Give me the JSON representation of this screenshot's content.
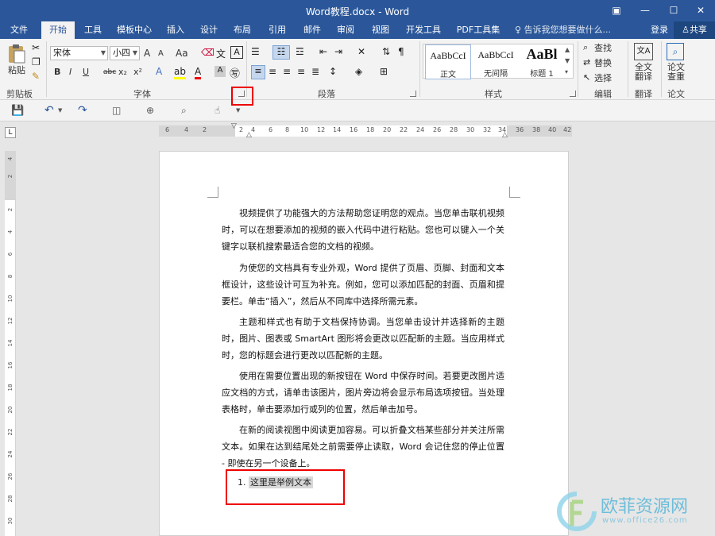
{
  "window": {
    "title": "Word教程.docx - Word"
  },
  "menu": {
    "tabs": [
      "文件",
      "开始",
      "工具",
      "模板中心",
      "插入",
      "设计",
      "布局",
      "引用",
      "邮件",
      "审阅",
      "视图",
      "开发工具",
      "PDF工具集"
    ],
    "active": "开始",
    "tell_me": "告诉我您想要做什么...",
    "login": "登录",
    "share": "共享"
  },
  "ribbon": {
    "clipboard": {
      "paste": "粘贴",
      "label": "剪贴板"
    },
    "font": {
      "name": "宋体",
      "size": "小四",
      "grow": "A",
      "shrink": "A",
      "case": "Aa",
      "bold": "B",
      "italic": "I",
      "underline": "U",
      "strike": "abc",
      "sub": "x₂",
      "sup": "x²",
      "label": "字体"
    },
    "paragraph": {
      "label": "段落"
    },
    "styles": {
      "items": [
        {
          "sample": "AaBbCcI",
          "name": "正文"
        },
        {
          "sample": "AaBbCcI",
          "name": "无间隔"
        },
        {
          "sample": "AaBl",
          "name": "标题 1"
        }
      ],
      "label": "样式"
    },
    "editing": {
      "find": "查找",
      "replace": "替换",
      "select": "选择",
      "label": "编辑"
    },
    "translate": {
      "btn": "全文翻译",
      "label": "翻译"
    },
    "paper": {
      "btn": "论文查重",
      "label": "论文"
    }
  },
  "ruler": {
    "h": [
      "6",
      "4",
      "2",
      "2",
      "4",
      "6",
      "8",
      "10",
      "12",
      "14",
      "16",
      "18",
      "20",
      "22",
      "24",
      "26",
      "28",
      "30",
      "32",
      "34",
      "36",
      "38",
      "40",
      "42"
    ],
    "v": [
      "4",
      "2",
      "2",
      "4",
      "6",
      "8",
      "10",
      "12",
      "14",
      "16",
      "18",
      "20",
      "22",
      "24",
      "26",
      "28",
      "30"
    ]
  },
  "document": {
    "paragraphs": [
      "视频提供了功能强大的方法帮助您证明您的观点。当您单击联机视频时，可以在想要添加的视频的嵌入代码中进行粘贴。您也可以键入一个关键字以联机搜索最适合您的文档的视频。",
      "为使您的文档具有专业外观，Word 提供了页眉、页脚、封面和文本框设计，这些设计可互为补充。例如，您可以添加匹配的封面、页眉和提要栏。单击“插入”，然后从不同库中选择所需元素。",
      "主题和样式也有助于文档保持协调。当您单击设计并选择新的主题时，图片、图表或 SmartArt 图形将会更改以匹配新的主题。当应用样式时，您的标题会进行更改以匹配新的主题。",
      "使用在需要位置出现的新按钮在 Word 中保存时间。若要更改图片适应文档的方式，请单击该图片，图片旁边将会显示布局选项按钮。当处理表格时，单击要添加行或列的位置，然后单击加号。",
      "在新的阅读视图中阅读更加容易。可以折叠文档某些部分并关注所需文本。如果在达到结尾处之前需要停止读取，Word 会记住您的停止位置 - 即使在另一个设备上。"
    ],
    "list": {
      "number": "1.",
      "text": "这里是举例文本"
    }
  },
  "watermark": {
    "brand": "欧菲资源网",
    "url": "www.office26.com"
  },
  "colors": {
    "accent": "#2b579a",
    "highlight": "#e00000"
  }
}
